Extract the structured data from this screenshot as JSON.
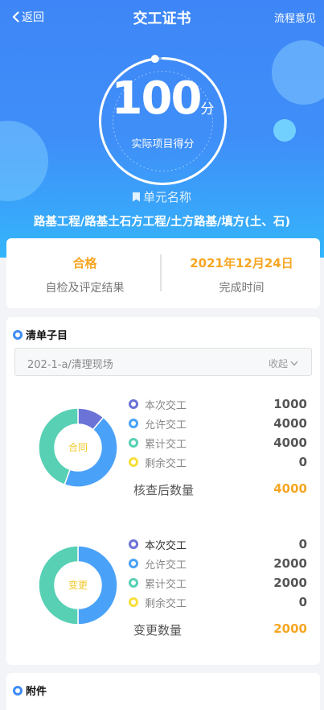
{
  "header": {
    "back_label": "返回",
    "title": "交工证书",
    "flow_label": "流程意见"
  },
  "score": {
    "value": "100",
    "unit": "分",
    "label": "实际项目得分",
    "progress": 0.98
  },
  "unit": {
    "label": "单元名称",
    "project_path": "路基工程/路基土石方工程/土方路基/填方(土、石)"
  },
  "result": {
    "status_value": "合格",
    "status_label": "自检及评定结果",
    "date_value": "2021年12月24日",
    "date_label": "完成时间"
  },
  "inventory": {
    "title": "清单子目",
    "selected_item": "202-1-a/清理现场",
    "collapse_label": "收起",
    "charts": [
      {
        "center_label": "合同",
        "legend": [
          {
            "label": "本次交工",
            "value": "1000",
            "color": "#6b73d6"
          },
          {
            "label": "允许交工",
            "value": "4000",
            "color": "#4aa2f8"
          },
          {
            "label": "累计交工",
            "value": "4000",
            "color": "#57d0b4"
          },
          {
            "label": "剩余交工",
            "value": "0",
            "color": "#f7df3b"
          }
        ],
        "slices": [
          1000,
          4000,
          4000,
          0
        ],
        "summary_label": "核查后数量",
        "summary_value": "4000"
      },
      {
        "center_label": "变更",
        "legend": [
          {
            "label": "本次交工",
            "value": "0",
            "color": "#6b73d6"
          },
          {
            "label": "允许交工",
            "value": "2000",
            "color": "#4aa2f8"
          },
          {
            "label": "累计交工",
            "value": "2000",
            "color": "#57d0b4"
          },
          {
            "label": "剩余交工",
            "value": "0",
            "color": "#f7df3b"
          }
        ],
        "slices": [
          0,
          2000,
          2000,
          0
        ],
        "summary_label": "变更数量",
        "summary_value": "2000"
      }
    ]
  },
  "attachments": {
    "title": "附件"
  },
  "colors": {
    "accent": "#3f8bf6",
    "highlight": "#f6a623",
    "center_text": "#f2c92c"
  }
}
